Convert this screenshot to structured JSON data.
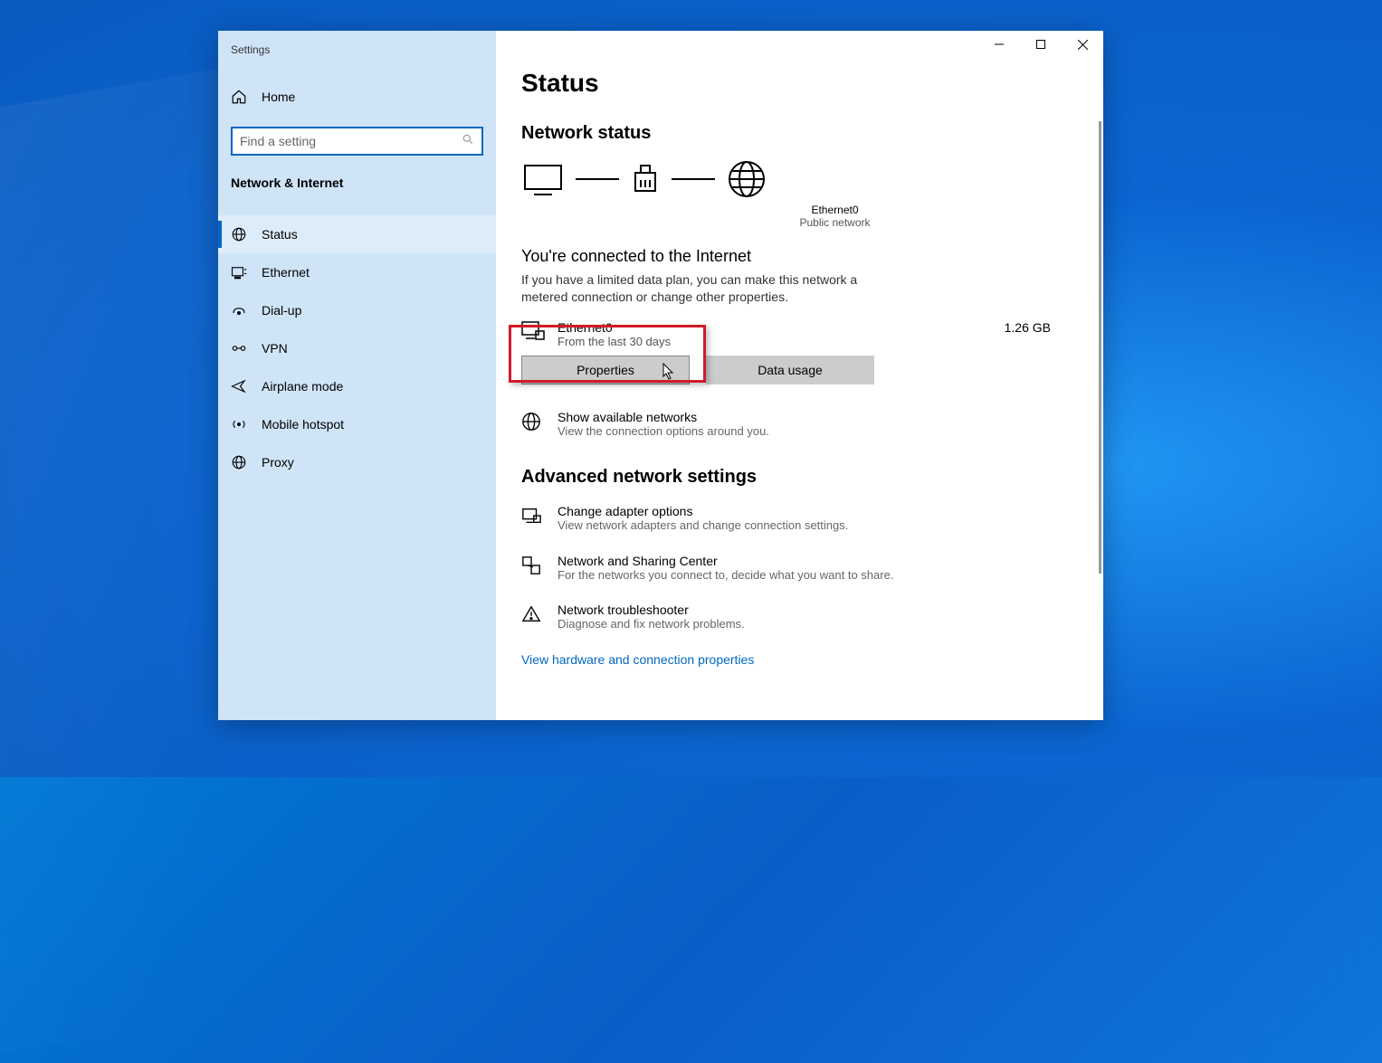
{
  "window": {
    "title": "Settings"
  },
  "sidebar": {
    "home": "Home",
    "search_placeholder": "Find a setting",
    "category": "Network & Internet",
    "items": [
      {
        "label": "Status",
        "icon": "status",
        "active": true
      },
      {
        "label": "Ethernet",
        "icon": "ethernet"
      },
      {
        "label": "Dial-up",
        "icon": "dialup"
      },
      {
        "label": "VPN",
        "icon": "vpn"
      },
      {
        "label": "Airplane mode",
        "icon": "airplane"
      },
      {
        "label": "Mobile hotspot",
        "icon": "hotspot"
      },
      {
        "label": "Proxy",
        "icon": "proxy"
      }
    ]
  },
  "main": {
    "page_title": "Status",
    "section1": "Network status",
    "diagram": {
      "adapter": "Ethernet0",
      "network_type": "Public network"
    },
    "connected_heading": "You're connected to the Internet",
    "connected_sub": "If you have a limited data plan, you can make this network a metered connection or change other properties.",
    "connection": {
      "name": "Ethernet0",
      "sub": "From the last 30 days",
      "usage": "1.26 GB",
      "btn_properties": "Properties",
      "btn_data_usage": "Data usage"
    },
    "options": [
      {
        "title": "Show available networks",
        "sub": "View the connection options around you.",
        "icon": "globe"
      },
      {
        "section": "Advanced network settings"
      },
      {
        "title": "Change adapter options",
        "sub": "View network adapters and change connection settings.",
        "icon": "adapter"
      },
      {
        "title": "Network and Sharing Center",
        "sub": "For the networks you connect to, decide what you want to share.",
        "icon": "share"
      },
      {
        "title": "Network troubleshooter",
        "sub": "Diagnose and fix network problems.",
        "icon": "warn"
      }
    ],
    "link": "View hardware and connection properties"
  }
}
